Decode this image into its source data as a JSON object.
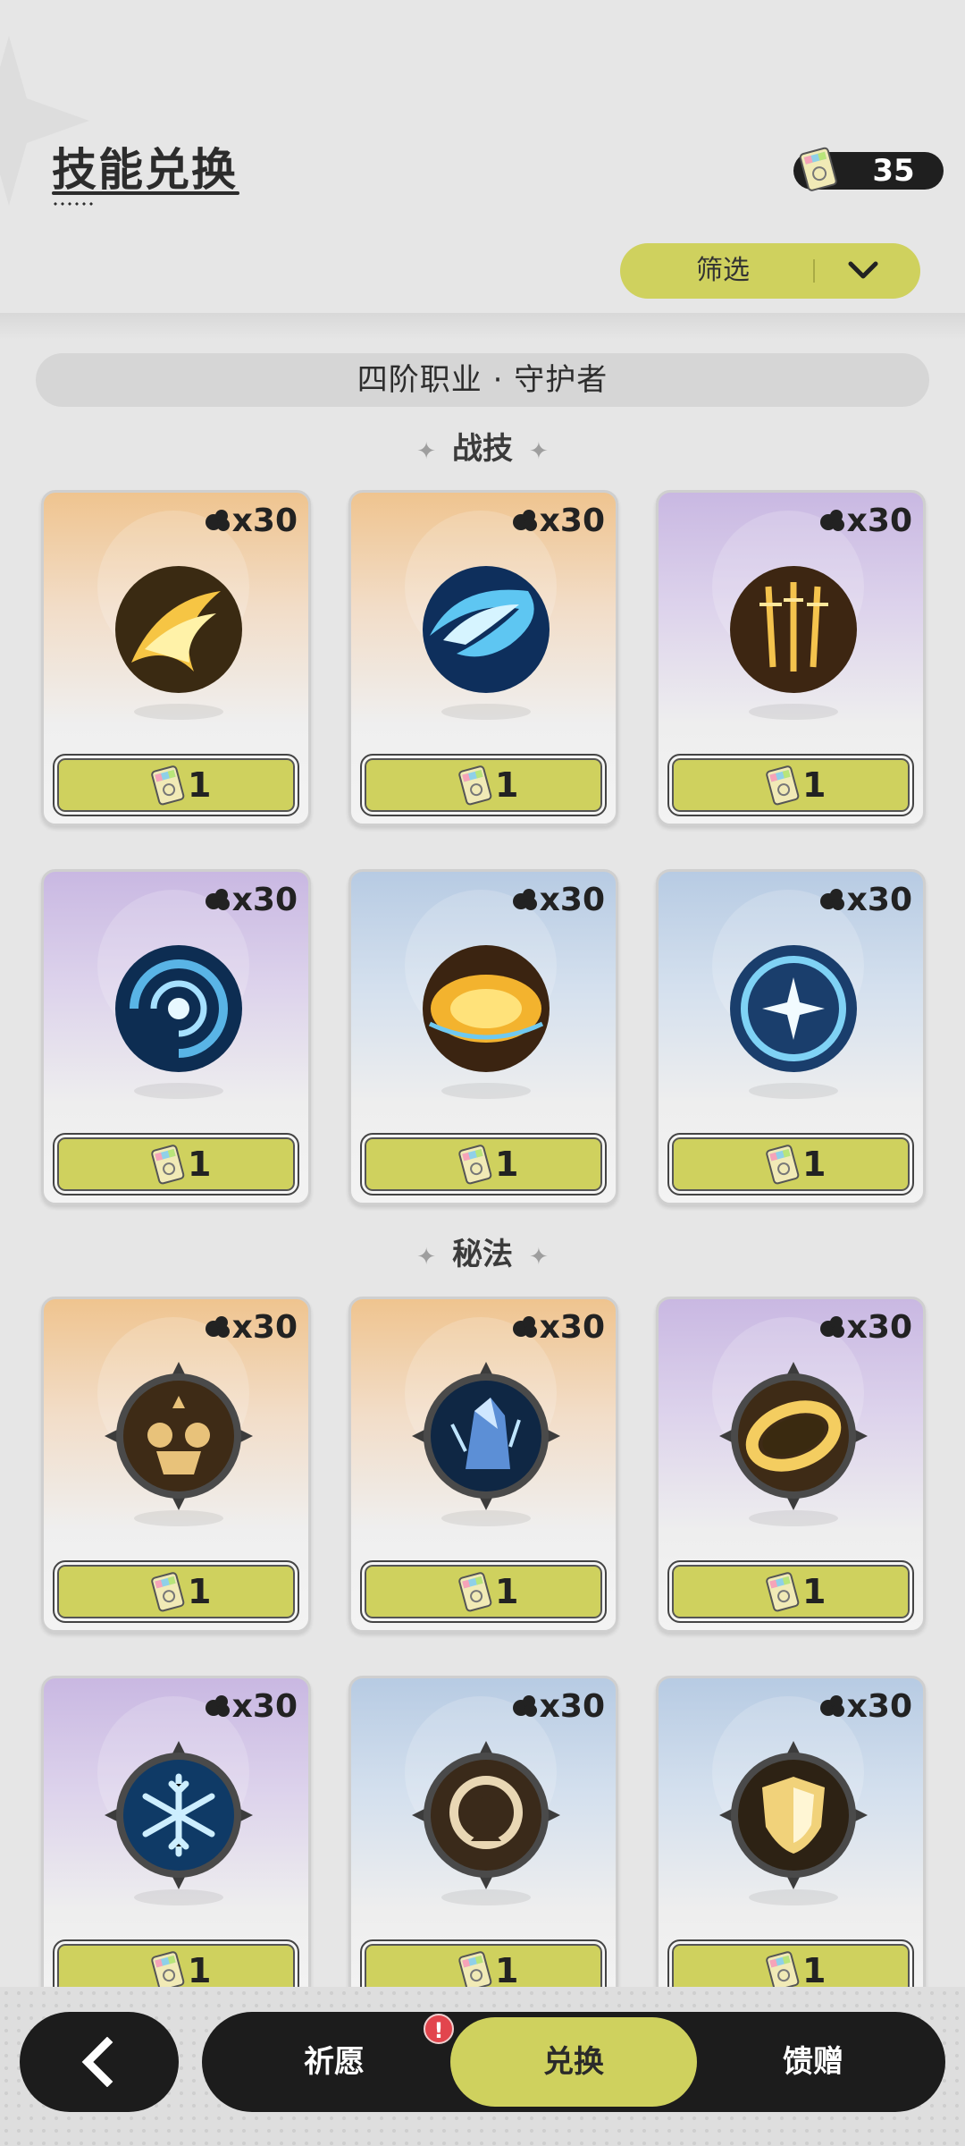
{
  "header": {
    "title": "技能兑换",
    "currency_value": "35"
  },
  "filter": {
    "label": "筛选",
    "icon": "chevron-down-icon"
  },
  "category": "四阶职业 · 守护者",
  "sections": [
    {
      "title": "战技",
      "cards": [
        {
          "theme": "orange",
          "icon": "golden-flame-slash-icon",
          "duplicate": "x30",
          "price": "1"
        },
        {
          "theme": "orange",
          "icon": "water-wave-icon",
          "duplicate": "x30",
          "price": "1"
        },
        {
          "theme": "purple",
          "icon": "golden-swords-icon",
          "duplicate": "x30",
          "price": "1"
        },
        {
          "theme": "purple",
          "icon": "blue-vortex-icon",
          "duplicate": "x30",
          "price": "1"
        },
        {
          "theme": "blue",
          "icon": "golden-burst-icon",
          "duplicate": "x30",
          "price": "1"
        },
        {
          "theme": "blue",
          "icon": "blue-star-shield-icon",
          "duplicate": "x30",
          "price": "1"
        }
      ]
    },
    {
      "title": "秘法",
      "cards": [
        {
          "theme": "orange",
          "icon": "group-rally-icon",
          "duplicate": "x30",
          "price": "1"
        },
        {
          "theme": "orange",
          "icon": "ice-crystal-icon",
          "duplicate": "x30",
          "price": "1"
        },
        {
          "theme": "purple",
          "icon": "golden-ring-icon",
          "duplicate": "x30",
          "price": "1"
        },
        {
          "theme": "purple",
          "icon": "snowflake-icon",
          "duplicate": "x30",
          "price": "1"
        },
        {
          "theme": "blue",
          "icon": "halo-figure-icon",
          "duplicate": "x30",
          "price": "1"
        },
        {
          "theme": "blue",
          "icon": "golden-shield-icon",
          "duplicate": "x30",
          "price": "1"
        }
      ]
    }
  ],
  "bottom_nav": {
    "back_icon": "back-arrow-icon",
    "tabs": [
      "祈愿",
      "兑换",
      "馈赠"
    ],
    "active_tab": "兑换",
    "alert": "!"
  },
  "colors": {
    "accent": "#cfd15e",
    "dark": "#1c1c1c",
    "alert": "#e2454d"
  }
}
